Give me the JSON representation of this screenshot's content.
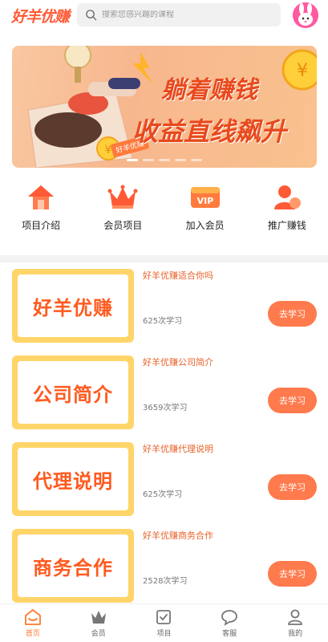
{
  "header": {
    "logo": "好羊优赚",
    "search_placeholder": "搜索您感兴趣的课程"
  },
  "banner": {
    "slogan_line1": "躺着赚钱",
    "slogan_line2": "收益直线飙升",
    "tag": "好羊优赚",
    "slide_count": 5,
    "active_slide": 1
  },
  "nav": [
    {
      "label": "项目介绍",
      "icon": "home-icon"
    },
    {
      "label": "会员项目",
      "icon": "crown-icon"
    },
    {
      "label": "加入会员",
      "icon": "vip-icon"
    },
    {
      "label": "推广赚钱",
      "icon": "user-promote-icon"
    }
  ],
  "courses": [
    {
      "thumb": "好羊优赚",
      "title": "好羊优赚适合你吗",
      "count": "625次学习",
      "button": "去学习"
    },
    {
      "thumb": "公司简介",
      "title": "好羊优赚公司简介",
      "count": "3659次学习",
      "button": "去学习"
    },
    {
      "thumb": "代理说明",
      "title": "好羊优赚代理说明",
      "count": "625次学习",
      "button": "去学习"
    },
    {
      "thumb": "商务合作",
      "title": "好羊优赚商务合作",
      "count": "2528次学习",
      "button": "去学习"
    }
  ],
  "tabbar": [
    {
      "label": "首页",
      "icon": "home-icon",
      "active": true
    },
    {
      "label": "会员",
      "icon": "crown-icon",
      "active": false
    },
    {
      "label": "项目",
      "icon": "checkbox-icon",
      "active": false
    },
    {
      "label": "客服",
      "icon": "chat-icon",
      "active": false
    },
    {
      "label": "我的",
      "icon": "person-icon",
      "active": false
    }
  ],
  "colors": {
    "accent": "#ff5a36",
    "button": "#ff7a4d",
    "thumb_frame": "#ffd56a",
    "tab_active": "#ff7a2d"
  }
}
